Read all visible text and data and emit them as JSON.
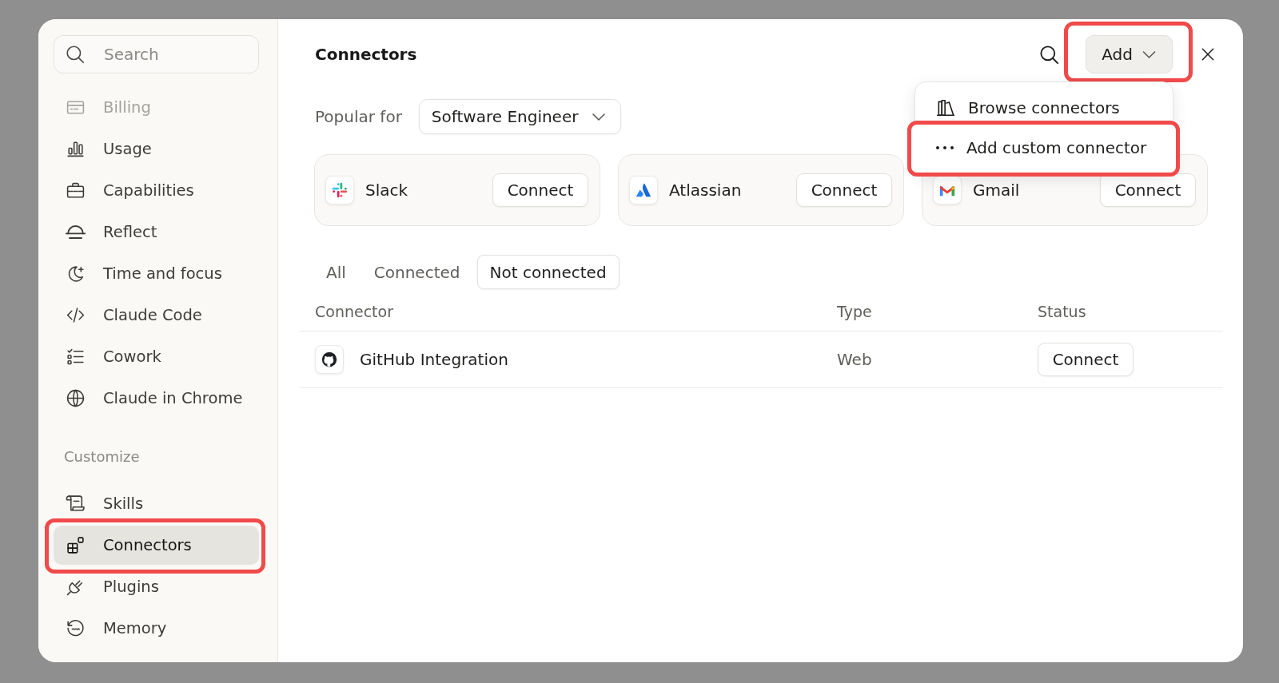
{
  "sidebar": {
    "search": {
      "placeholder": "Search"
    },
    "groups": [
      {
        "items": [
          {
            "label": "Billing",
            "selected": false,
            "disabled": true,
            "highlighted": false
          },
          {
            "label": "Usage",
            "selected": false,
            "disabled": false,
            "highlighted": false
          },
          {
            "label": "Capabilities",
            "selected": false,
            "disabled": false,
            "highlighted": false
          },
          {
            "label": "Reflect",
            "selected": false,
            "disabled": false,
            "highlighted": false
          },
          {
            "label": "Time and focus",
            "selected": false,
            "disabled": false,
            "highlighted": false
          },
          {
            "label": "Claude Code",
            "selected": false,
            "disabled": false,
            "highlighted": false
          },
          {
            "label": "Cowork",
            "selected": false,
            "disabled": false,
            "highlighted": false
          },
          {
            "label": "Claude in Chrome",
            "selected": false,
            "disabled": false,
            "highlighted": false
          }
        ]
      },
      {
        "heading": "Customize",
        "items": [
          {
            "label": "Skills",
            "selected": false,
            "disabled": false,
            "highlighted": false
          },
          {
            "label": "Connectors",
            "selected": true,
            "disabled": false,
            "highlighted": true
          },
          {
            "label": "Plugins",
            "selected": false,
            "disabled": false,
            "highlighted": false
          },
          {
            "label": "Memory",
            "selected": false,
            "disabled": false,
            "highlighted": false
          }
        ]
      }
    ]
  },
  "header": {
    "title": "Connectors",
    "add_button": {
      "label": "Add",
      "highlighted": true
    },
    "menu": {
      "items": [
        {
          "label": "Browse connectors",
          "highlighted": false
        },
        {
          "label": "Add custom connector",
          "highlighted": true
        }
      ]
    }
  },
  "popular": {
    "label": "Popular for",
    "select": {
      "value": "Software Engineer"
    }
  },
  "featured": [
    {
      "name": "Slack",
      "button": "Connect"
    },
    {
      "name": "Atlassian",
      "button": "Connect"
    },
    {
      "name": "Gmail",
      "button": "Connect"
    }
  ],
  "filter_tabs": [
    {
      "label": "All",
      "selected": false
    },
    {
      "label": "Connected",
      "selected": false
    },
    {
      "label": "Not connected",
      "selected": true
    }
  ],
  "table": {
    "columns": [
      "Connector",
      "Type",
      "Status"
    ],
    "rows": [
      {
        "connector": "GitHub Integration",
        "type": "Web",
        "action": "Connect"
      }
    ]
  }
}
